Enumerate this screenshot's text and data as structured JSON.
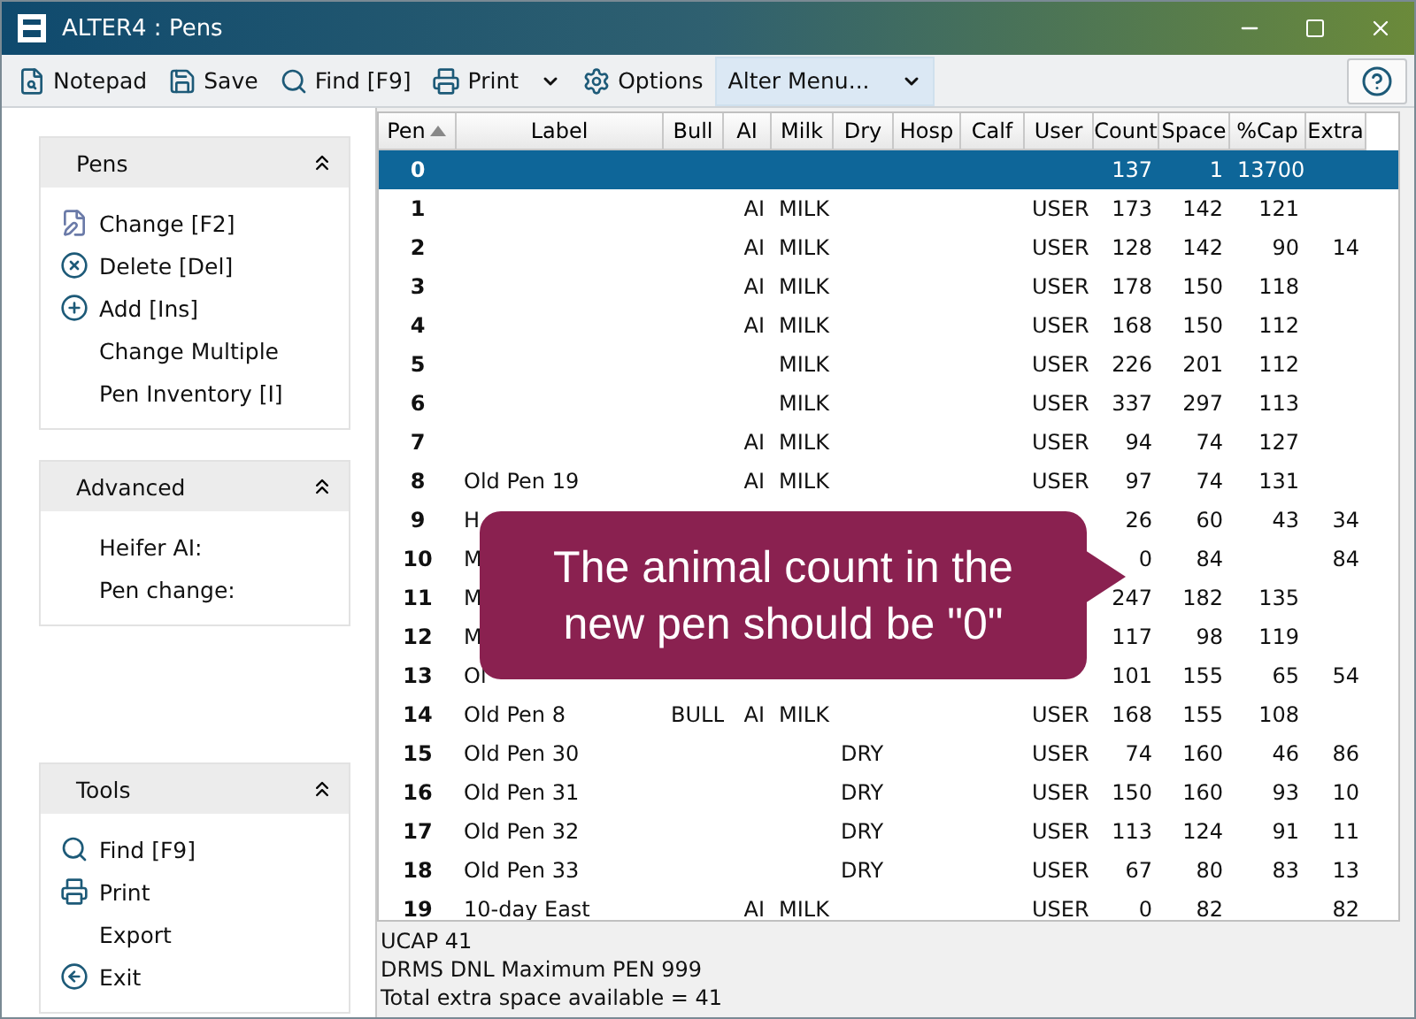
{
  "window": {
    "title": "ALTER4 : Pens"
  },
  "toolbar": {
    "items": [
      {
        "kind": "notepad",
        "label": "Notepad"
      },
      {
        "kind": "save",
        "label": "Save"
      },
      {
        "kind": "find",
        "label": "Find [F9]"
      },
      {
        "kind": "print",
        "label": "Print"
      },
      {
        "kind": "dropdown"
      },
      {
        "kind": "options",
        "label": "Options"
      },
      {
        "kind": "menu",
        "label": "Alter Menu...",
        "selected": true
      }
    ]
  },
  "sidebar": {
    "panels": [
      {
        "title": "Pens",
        "items": [
          {
            "kind": "change",
            "label": "Change [F2]"
          },
          {
            "kind": "delete",
            "label": "Delete [Del]"
          },
          {
            "kind": "add",
            "label": "Add [Ins]"
          },
          {
            "kind": "plain",
            "label": "Change Multiple"
          },
          {
            "kind": "plain",
            "label": "Pen Inventory [I]"
          }
        ]
      },
      {
        "title": "Advanced",
        "items": [
          {
            "kind": "plain",
            "label": "Heifer AI:"
          },
          {
            "kind": "plain",
            "label": "Pen change:"
          }
        ]
      },
      {
        "title": "Tools",
        "items": [
          {
            "kind": "find",
            "label": "Find [F9]"
          },
          {
            "kind": "print",
            "label": "Print"
          },
          {
            "kind": "plain",
            "label": "Export"
          },
          {
            "kind": "exit",
            "label": "Exit"
          }
        ]
      }
    ]
  },
  "table": {
    "columns": [
      {
        "label": "Pen",
        "sorted": true
      },
      {
        "label": "Label",
        "sorted": false
      },
      {
        "label": "Bull",
        "sorted": false
      },
      {
        "label": "AI",
        "sorted": false
      },
      {
        "label": "Milk",
        "sorted": false
      },
      {
        "label": "Dry",
        "sorted": false
      },
      {
        "label": "Hosp",
        "sorted": false
      },
      {
        "label": "Calf",
        "sorted": false
      },
      {
        "label": "User",
        "sorted": false
      },
      {
        "label": "Count",
        "sorted": false
      },
      {
        "label": "Space",
        "sorted": false
      },
      {
        "label": "%Cap",
        "sorted": false
      },
      {
        "label": "Extra",
        "sorted": false
      }
    ],
    "rows": [
      {
        "selected": true,
        "cells": [
          "0",
          null,
          null,
          null,
          null,
          null,
          null,
          null,
          null,
          "137",
          "1",
          "13700",
          null
        ]
      },
      {
        "selected": false,
        "cells": [
          "1",
          null,
          null,
          "AI",
          "MILK",
          null,
          null,
          null,
          "USER",
          "173",
          "142",
          "121",
          null
        ]
      },
      {
        "selected": false,
        "cells": [
          "2",
          null,
          null,
          "AI",
          "MILK",
          null,
          null,
          null,
          "USER",
          "128",
          "142",
          "90",
          "14"
        ]
      },
      {
        "selected": false,
        "cells": [
          "3",
          null,
          null,
          "AI",
          "MILK",
          null,
          null,
          null,
          "USER",
          "178",
          "150",
          "118",
          null
        ]
      },
      {
        "selected": false,
        "cells": [
          "4",
          null,
          null,
          "AI",
          "MILK",
          null,
          null,
          null,
          "USER",
          "168",
          "150",
          "112",
          null
        ]
      },
      {
        "selected": false,
        "cells": [
          "5",
          null,
          null,
          null,
          "MILK",
          null,
          null,
          null,
          "USER",
          "226",
          "201",
          "112",
          null
        ]
      },
      {
        "selected": false,
        "cells": [
          "6",
          null,
          null,
          null,
          "MILK",
          null,
          null,
          null,
          "USER",
          "337",
          "297",
          "113",
          null
        ]
      },
      {
        "selected": false,
        "cells": [
          "7",
          null,
          null,
          "AI",
          "MILK",
          null,
          null,
          null,
          "USER",
          "94",
          "74",
          "127",
          null
        ]
      },
      {
        "selected": false,
        "cells": [
          "8",
          "Old Pen 19",
          null,
          "AI",
          "MILK",
          null,
          null,
          null,
          "USER",
          "97",
          "74",
          "131",
          null
        ]
      },
      {
        "selected": false,
        "cells": [
          "9",
          "H",
          null,
          null,
          null,
          null,
          null,
          null,
          null,
          "26",
          "60",
          "43",
          "34"
        ]
      },
      {
        "selected": false,
        "cells": [
          "10",
          "M",
          null,
          null,
          null,
          null,
          null,
          null,
          null,
          "0",
          "84",
          null,
          "84"
        ]
      },
      {
        "selected": false,
        "cells": [
          "11",
          "M",
          null,
          null,
          null,
          null,
          null,
          null,
          null,
          "247",
          "182",
          "135",
          null
        ]
      },
      {
        "selected": false,
        "cells": [
          "12",
          "M",
          null,
          null,
          null,
          null,
          null,
          null,
          null,
          "117",
          "98",
          "119",
          null
        ]
      },
      {
        "selected": false,
        "cells": [
          "13",
          "Ol",
          null,
          null,
          null,
          null,
          null,
          null,
          null,
          "101",
          "155",
          "65",
          "54"
        ]
      },
      {
        "selected": false,
        "cells": [
          "14",
          "Old Pen 8",
          "BULL",
          "AI",
          "MILK",
          null,
          null,
          null,
          "USER",
          "168",
          "155",
          "108",
          null
        ]
      },
      {
        "selected": false,
        "cells": [
          "15",
          "Old Pen 30",
          null,
          null,
          null,
          "DRY",
          null,
          null,
          "USER",
          "74",
          "160",
          "46",
          "86"
        ]
      },
      {
        "selected": false,
        "cells": [
          "16",
          "Old Pen 31",
          null,
          null,
          null,
          "DRY",
          null,
          null,
          "USER",
          "150",
          "160",
          "93",
          "10"
        ]
      },
      {
        "selected": false,
        "cells": [
          "17",
          "Old Pen 32",
          null,
          null,
          null,
          "DRY",
          null,
          null,
          "USER",
          "113",
          "124",
          "91",
          "11"
        ]
      },
      {
        "selected": false,
        "cells": [
          "18",
          "Old Pen 33",
          null,
          null,
          null,
          "DRY",
          null,
          null,
          "USER",
          "67",
          "80",
          "83",
          "13"
        ]
      },
      {
        "selected": false,
        "cells": [
          "19",
          "10-day East",
          null,
          "AI",
          "MILK",
          null,
          null,
          null,
          "USER",
          "0",
          "82",
          null,
          "82"
        ]
      }
    ]
  },
  "status_bar": {
    "lines": [
      "UCAP 41",
      "DRMS DNL Maximum PEN 999",
      "Total extra space available = 41"
    ]
  },
  "callout": {
    "text": "The animal count in the new pen should be \"0\""
  }
}
